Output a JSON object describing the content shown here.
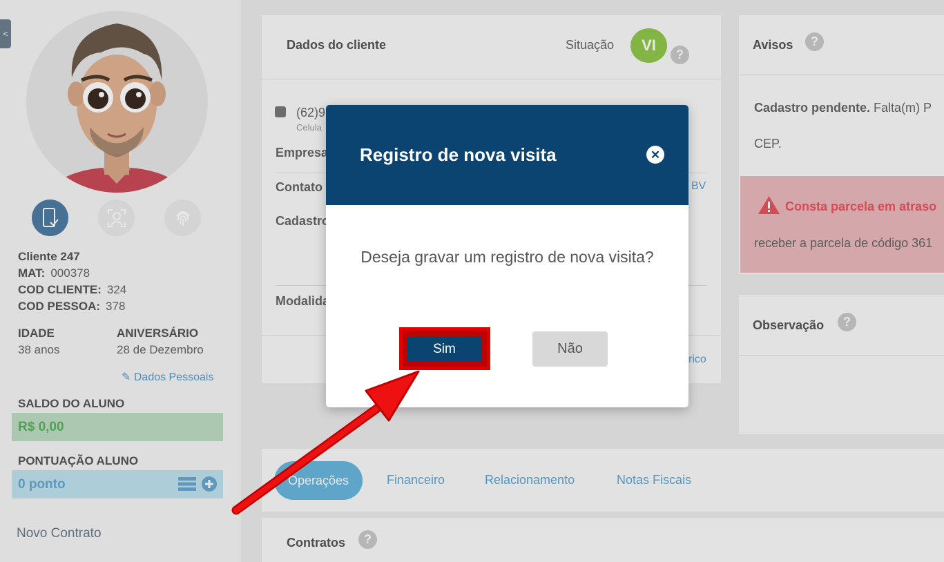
{
  "sidebar": {
    "collapse_label": "<",
    "client_name": "Cliente 247",
    "mat_label": "MAT:",
    "mat_value": "000378",
    "cod_cliente_label": "COD CLIENTE:",
    "cod_cliente_value": "324",
    "cod_pessoa_label": "COD PESSOA:",
    "cod_pessoa_value": "378",
    "idade_label": "IDADE",
    "idade_value": "38 anos",
    "aniversario_label": "ANIVERSÁRIO",
    "aniversario_value": "28 de Dezembro",
    "dados_pessoais_link": "Dados Pessoais",
    "saldo_label": "SALDO DO ALUNO",
    "saldo_value": "R$ 0,00",
    "pontuacao_label": "PONTUAÇÃO ALUNO",
    "pontuacao_value": "0 ponto",
    "novo_contrato": "Novo Contrato",
    "icons": [
      "mobile-check-icon",
      "face-recognition-icon",
      "fingerprint-icon"
    ]
  },
  "dados_cliente": {
    "title": "Dados do cliente",
    "situacao_label": "Situação",
    "situacao_badge": "VI",
    "phone_partial": "(62)9",
    "phone_type_partial": "Celula",
    "empresa_partial": "Empresa",
    "contato_partial": "Contato",
    "contato_suffix": "BV",
    "cadastro_partial": "Cadastro",
    "modalidade_partial": "Modalida",
    "historico_partial": "rico"
  },
  "avisos": {
    "title": "Avisos",
    "cadastro_pendente_bold": "Cadastro pendente.",
    "cadastro_pendente_text": "Falta(m) P",
    "cep": "CEP.",
    "alert_title": "Consta parcela em atraso",
    "alert_text": "receber a parcela de código 361"
  },
  "observacao": {
    "title": "Observação"
  },
  "tabs": [
    "Operações",
    "Financeiro",
    "Relacionamento",
    "Notas Fiscais"
  ],
  "contratos": {
    "title": "Contratos"
  },
  "modal": {
    "title": "Registro de nova visita",
    "question": "Deseja gravar um registro de nova visita?",
    "confirm_label": "Sim",
    "cancel_label": "Não"
  },
  "colors": {
    "modal_header": "#0b4470",
    "highlight": "#e00000",
    "badge": "#8fc74b",
    "tab_active": "#69b6de"
  }
}
